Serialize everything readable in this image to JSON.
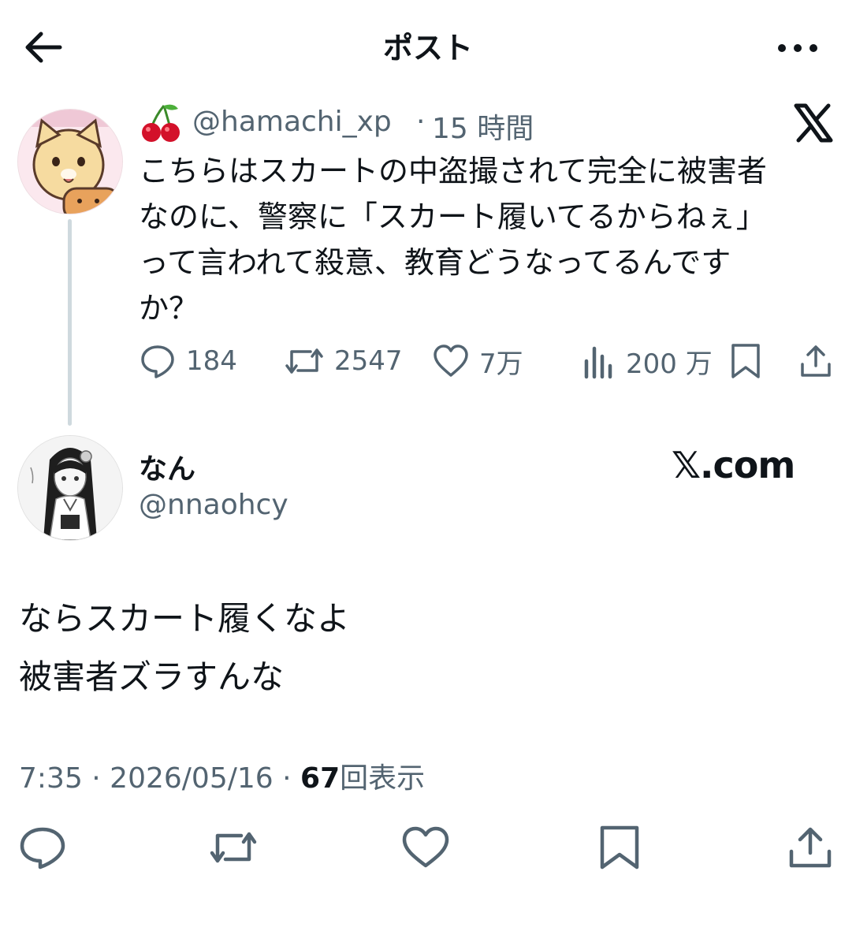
{
  "header": {
    "title": "ポスト"
  },
  "quoted_tweet": {
    "emoji": "🍒",
    "handle": "@hamachi_xp",
    "dot": "·",
    "time": "15 時間",
    "lines": [
      "こちらはスカートの中盗撮されて完全に被害者",
      "なのに、警察に「スカート履いてるからねぇ」",
      "って言われて殺意、教育どうなってるんです",
      "か？"
    ],
    "stats": {
      "replies": "184",
      "reposts": "2547",
      "likes": "7万",
      "views": "200 万"
    }
  },
  "reply_tweet": {
    "name": "なん",
    "handle": "@nnaohcy",
    "watermark": "𝕏.com",
    "lines": [
      "ならスカート履くなよ",
      "被害者ズラすんな"
    ],
    "time": "7:35 · 2026/05/16 ·",
    "view_count": "67",
    "view_label": "回表示"
  },
  "colors": {
    "text": "#0f1419",
    "secondary": "#536471",
    "thread_line": "#cfd9de",
    "background": "#ffffff"
  },
  "icons": [
    "back-arrow-icon",
    "more-icon",
    "cherry-icon",
    "x-logo-icon",
    "reply-icon",
    "repost-icon",
    "like-icon",
    "views-icon",
    "bookmark-icon",
    "share-icon"
  ]
}
